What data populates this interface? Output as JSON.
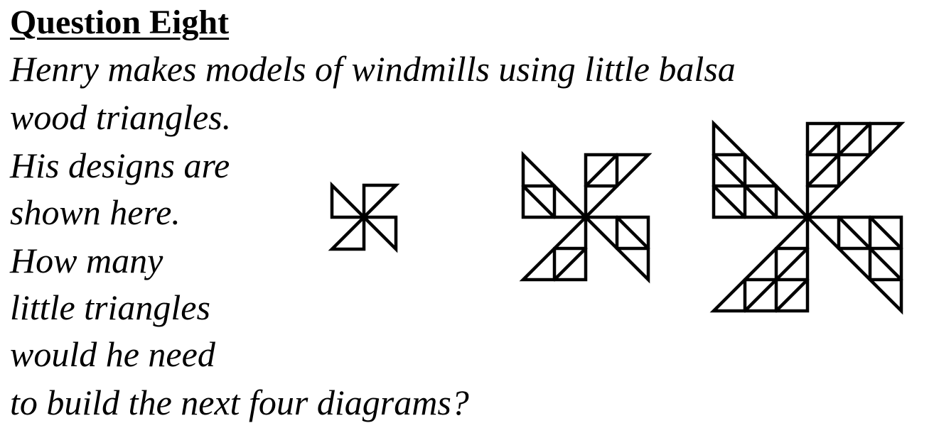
{
  "question": {
    "title": "Question Eight",
    "lines": [
      "Henry makes models of windmills using little balsa",
      "wood triangles.",
      "His designs are",
      "shown here.",
      "How many",
      "little triangles",
      "would he need",
      "to build the next four diagrams?"
    ]
  },
  "figures": [
    {
      "name": "windmill-design-1",
      "blade_size": 1,
      "triangles_per_blade": 1,
      "total_triangles": 4
    },
    {
      "name": "windmill-design-2",
      "blade_size": 2,
      "triangles_per_blade": 4,
      "total_triangles": 16
    },
    {
      "name": "windmill-design-3",
      "blade_size": 3,
      "triangles_per_blade": 9,
      "total_triangles": 36
    }
  ]
}
